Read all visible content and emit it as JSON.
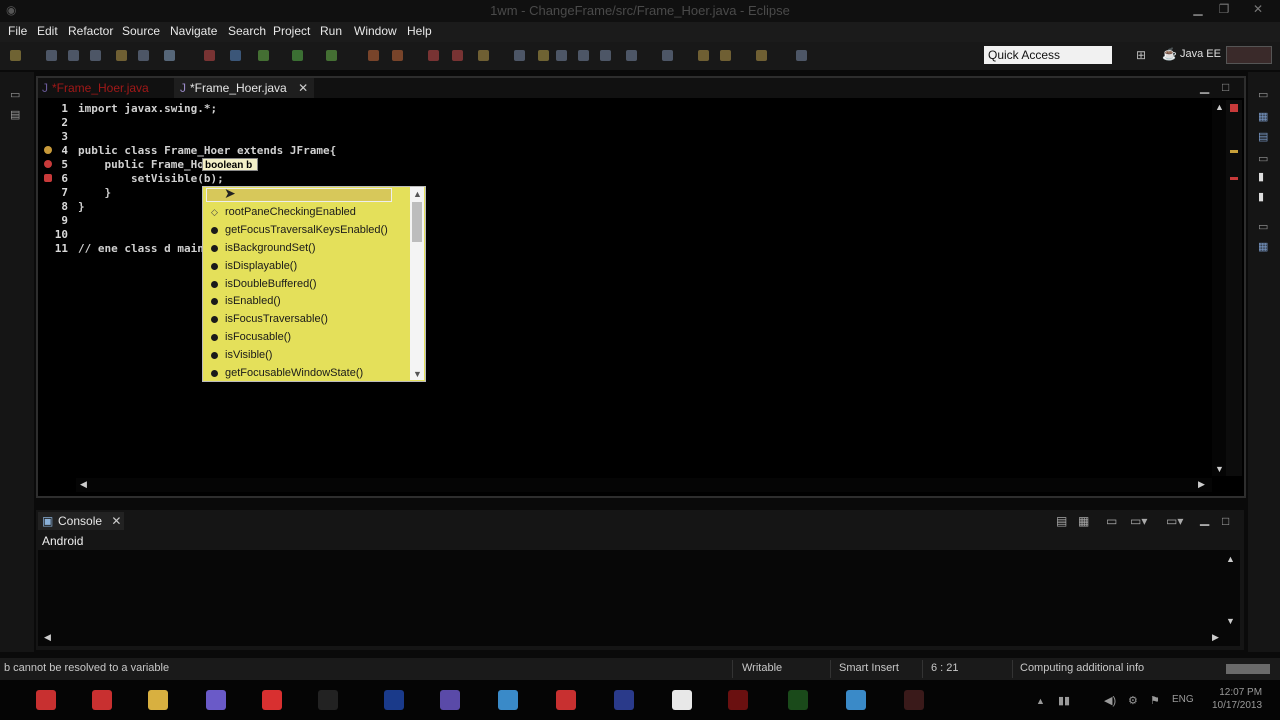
{
  "window": {
    "title": "1wm - ChangeFrame/src/Frame_Hoer.java - Eclipse"
  },
  "menu": [
    "File",
    "Edit",
    "Refactor",
    "Source",
    "Navigate",
    "Search",
    "Project",
    "Run",
    "Window",
    "Help"
  ],
  "toolbar": {
    "quick_access": "Quick Access",
    "perspective": "Java EE"
  },
  "editor": {
    "tabs": [
      {
        "label": "*Frame_Hoer.java",
        "active": false
      },
      {
        "label": "*Frame_Hoer.java",
        "active": true
      }
    ],
    "lines": [
      {
        "no": "1",
        "code": "import javax.swing.*;"
      },
      {
        "no": "2",
        "code": ""
      },
      {
        "no": "3",
        "code": ""
      },
      {
        "no": "4",
        "code": "public class Frame_Hoer extends JFrame{"
      },
      {
        "no": "5",
        "code": "    public Frame_Ho"
      },
      {
        "no": "6",
        "code": "        setVisible(b);"
      },
      {
        "no": "7",
        "code": "    }"
      },
      {
        "no": "8",
        "code": "}"
      },
      {
        "no": "9",
        "code": ""
      },
      {
        "no": "10",
        "code": ""
      },
      {
        "no": "11",
        "code": "// ene class d main"
      }
    ],
    "tooltip": "boolean b",
    "proposals": [
      {
        "label": "rootPaneCheckingEnabled",
        "kind": "field"
      },
      {
        "label": "getFocusTraversalKeysEnabled()",
        "kind": "method"
      },
      {
        "label": "isBackgroundSet()",
        "kind": "method"
      },
      {
        "label": "isDisplayable()",
        "kind": "method"
      },
      {
        "label": "isDoubleBuffered()",
        "kind": "method"
      },
      {
        "label": "isEnabled()",
        "kind": "method"
      },
      {
        "label": "isFocusTraversable()",
        "kind": "method"
      },
      {
        "label": "isFocusable()",
        "kind": "method"
      },
      {
        "label": "isVisible()",
        "kind": "method"
      },
      {
        "label": "getFocusableWindowState()",
        "kind": "method"
      }
    ]
  },
  "console": {
    "tab": "Console",
    "sub": "Android"
  },
  "status": {
    "message": "b cannot be resolved to a variable",
    "mode": "Writable",
    "insert": "Smart Insert",
    "position": "6 : 21",
    "progress": "Computing additional info"
  },
  "taskbar": {
    "lang": "ENG",
    "time": "12:07 PM",
    "date": "10/17/2013"
  },
  "colors": {
    "highlight": "#5aa0e8",
    "popup": "#e4e05a",
    "tooltip": "#f3f0c8"
  }
}
